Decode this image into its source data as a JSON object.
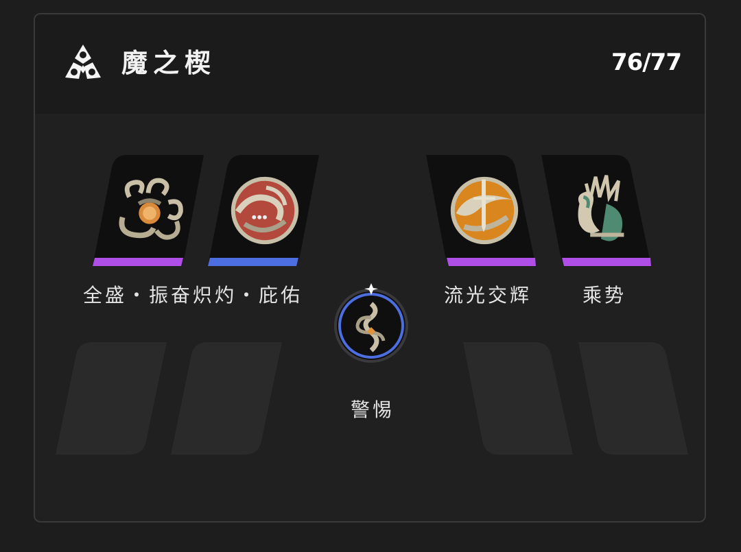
{
  "header": {
    "title": "魔之楔",
    "count": "76/77",
    "logo_icon": "trefoil-logo-icon"
  },
  "colors": {
    "purple_bar": "#b04ee8",
    "blue_bar": "#4d6ee0",
    "panel_bg": "#202021",
    "card_bg": "#0f0f10",
    "ghost_slot": "#2a2a2b"
  },
  "left_group": {
    "label": "全盛・振奋炽灼・庇佑",
    "slots": [
      {
        "icon": "hydra-emblem-icon",
        "bar_color": "#b04ee8"
      },
      {
        "icon": "swirl-emblem-icon",
        "bar_color": "#4d6ee0"
      }
    ]
  },
  "center": {
    "label": "警惕",
    "icon": "serpent-emblem-icon"
  },
  "right_group": [
    {
      "label": "流光交辉",
      "icon": "winged-sword-emblem-icon",
      "bar_color": "#b04ee8"
    },
    {
      "label": "乘势",
      "icon": "beast-crest-emblem-icon",
      "bar_color": "#b04ee8"
    }
  ]
}
